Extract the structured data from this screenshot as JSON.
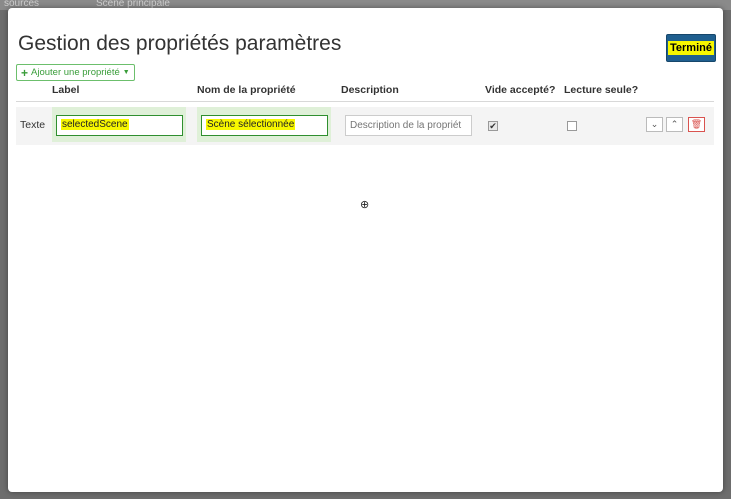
{
  "background": {
    "left_text": "sources",
    "scene_tab": "Scène principale"
  },
  "modal": {
    "title": "Gestion des propriétés paramètres",
    "done_label": "Terminé",
    "add_property_label": "Ajouter une propriété"
  },
  "table": {
    "headers": {
      "label": "Label",
      "property_name": "Nom de la propriété",
      "description": "Description",
      "empty_allowed": "Vide accepté?",
      "read_only": "Lecture seule?"
    },
    "rows": [
      {
        "type": "Texte",
        "label": "selectedScene",
        "property_name": "Scène sélectionnée",
        "description_placeholder": "Description de la propriét",
        "empty_allowed": true,
        "read_only": false
      }
    ]
  },
  "colors": {
    "accent_green": "#3a9d3a",
    "highlight": "#f7f700",
    "done_button": "#1f5f8f",
    "delete": "#d9534f"
  }
}
